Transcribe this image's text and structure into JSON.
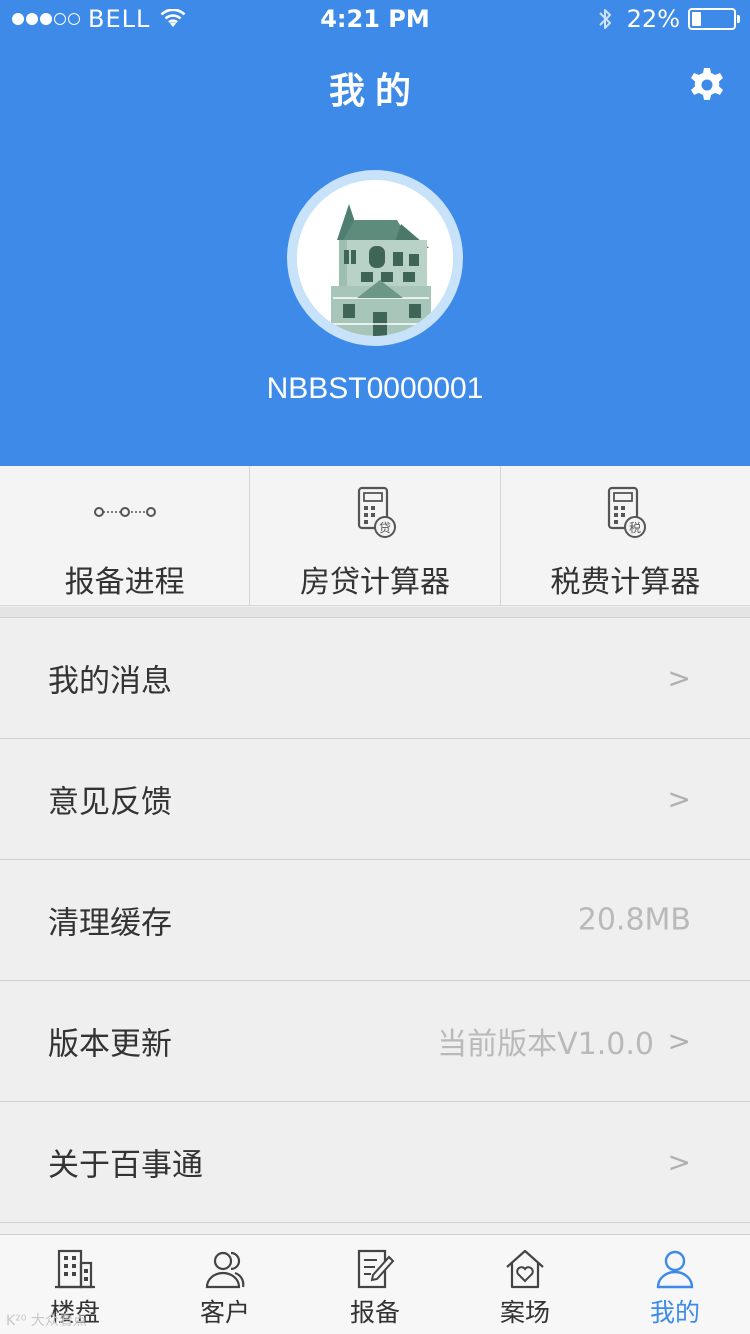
{
  "status_bar": {
    "carrier": "BELL",
    "time": "4:21 PM",
    "battery_pct": "22%",
    "battery_level": 0.22,
    "signal_bars_filled": 3,
    "signal_bars_total": 5
  },
  "header": {
    "title": "我的",
    "settings_icon": "gear-icon",
    "username": "NBBST0000001",
    "avatar_icon": "house-avatar"
  },
  "tools": [
    {
      "label": "报备进程",
      "icon": "progress-steps-icon"
    },
    {
      "label": "房贷计算器",
      "icon": "loan-calculator-icon",
      "badge": "贷"
    },
    {
      "label": "税费计算器",
      "icon": "tax-calculator-icon",
      "badge": "税"
    }
  ],
  "menu": [
    {
      "label": "我的消息",
      "value": "",
      "arrow": ">"
    },
    {
      "label": "意见反馈",
      "value": "",
      "arrow": ">"
    },
    {
      "label": "清理缓存",
      "value": "20.8MB",
      "arrow": ""
    },
    {
      "label": "版本更新",
      "value": "当前版本V1.0.0",
      "arrow": ">"
    },
    {
      "label": "关于百事通",
      "value": "",
      "arrow": ">"
    }
  ],
  "tabbar": [
    {
      "label": "楼盘",
      "icon": "building-icon",
      "active": false
    },
    {
      "label": "客户",
      "icon": "customers-icon",
      "active": false
    },
    {
      "label": "报备",
      "icon": "report-edit-icon",
      "active": false
    },
    {
      "label": "案场",
      "icon": "house-heart-icon",
      "active": false
    },
    {
      "label": "我的",
      "icon": "user-icon",
      "active": true
    }
  ],
  "colors": {
    "primary": "#3d8ae8",
    "background": "#efefef",
    "text": "#333333",
    "muted": "#b9b9b9"
  },
  "watermark": "K²⁰ 大众看点"
}
